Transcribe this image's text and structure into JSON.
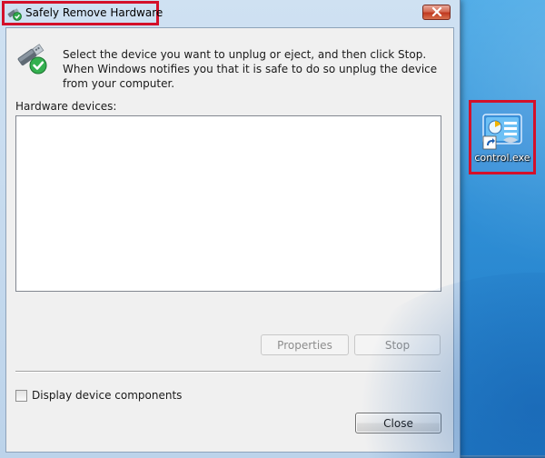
{
  "window": {
    "title": "Safely Remove Hardware",
    "instructions": "Select the device you want to unplug or eject, and then click Stop. When Windows notifies you that it is safe to do so unplug the device from your computer.",
    "devices_label": "Hardware devices:",
    "devices": [],
    "buttons": {
      "properties": "Properties",
      "stop": "Stop",
      "close": "Close"
    },
    "checkbox_label": "Display device components",
    "checkbox_checked": false
  },
  "desktop": {
    "shortcut_label": "control.exe"
  },
  "icons": {
    "title": "safely-remove-hardware-icon",
    "device": "usb-device-check-icon",
    "close": "close-icon",
    "shortcut": "control-panel-shortcut-icon"
  },
  "colors": {
    "highlight": "#d4102a",
    "desktop": "#2f8fd6",
    "close_button": "#c0391f"
  }
}
